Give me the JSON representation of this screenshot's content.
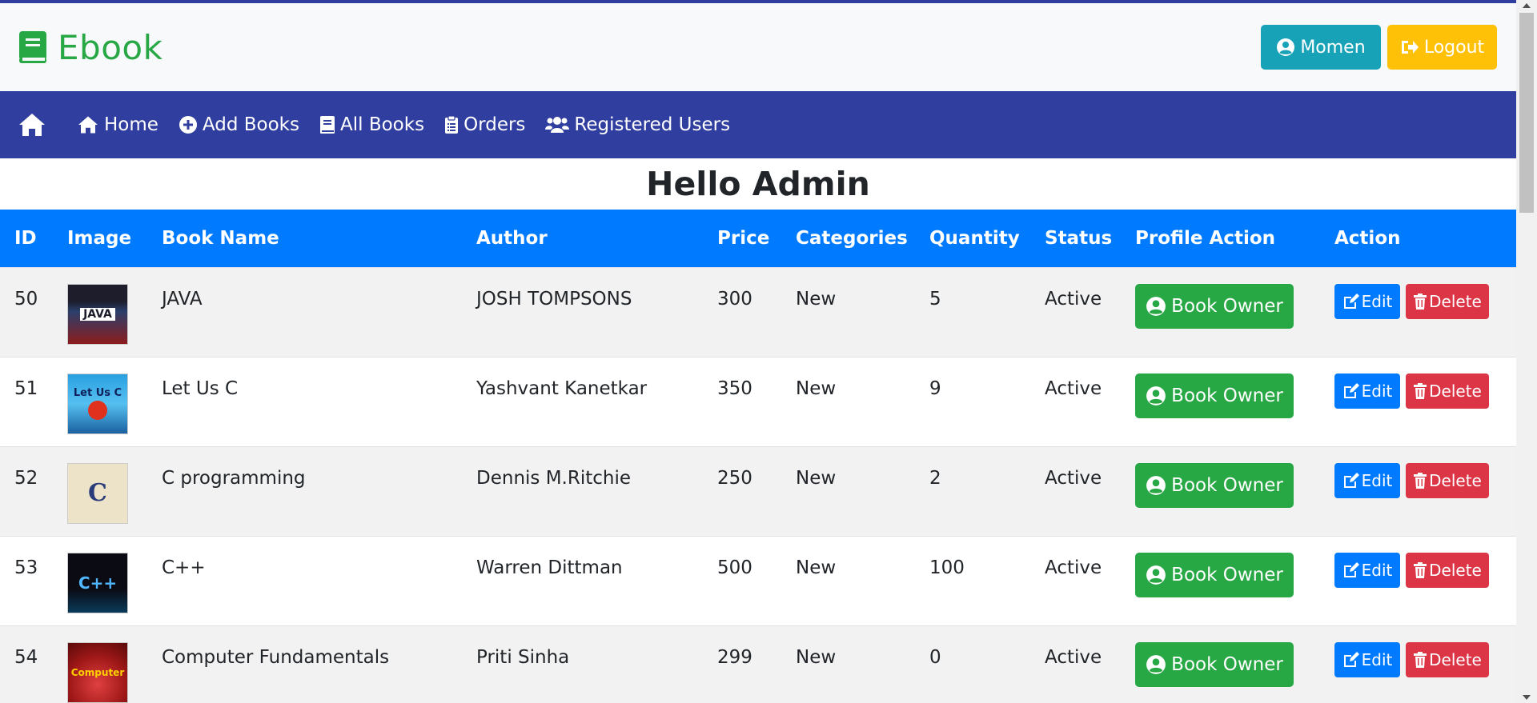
{
  "brand": {
    "name": "Ebook",
    "color": "#28a745",
    "icon": "book-icon"
  },
  "header": {
    "user_label": "Momen",
    "logout_label": "Logout"
  },
  "nav": {
    "home_icon": "home-icon",
    "items": [
      {
        "label": "Home",
        "icon": "home-icon"
      },
      {
        "label": "Add Books",
        "icon": "plus-circle-icon"
      },
      {
        "label": "All Books",
        "icon": "book-icon"
      },
      {
        "label": "Orders",
        "icon": "clipboard-icon"
      },
      {
        "label": "Registered Users",
        "icon": "users-icon"
      }
    ]
  },
  "page": {
    "title": "Hello Admin"
  },
  "table": {
    "columns": [
      "ID",
      "Image",
      "Book Name",
      "Author",
      "Price",
      "Categories",
      "Quantity",
      "Status",
      "Profile Action",
      "Action"
    ],
    "rows": [
      {
        "id": "50",
        "cover": "JAVA",
        "name": "JAVA",
        "author": "JOSH TOMPSONS",
        "price": "300",
        "category": "New",
        "quantity": "5",
        "status": "Active"
      },
      {
        "id": "51",
        "cover": "Let Us C",
        "name": "Let Us C",
        "author": "Yashvant Kanetkar",
        "price": "350",
        "category": "New",
        "quantity": "9",
        "status": "Active"
      },
      {
        "id": "52",
        "cover": "C",
        "name": "C programming",
        "author": "Dennis M.Ritchie",
        "price": "250",
        "category": "New",
        "quantity": "2",
        "status": "Active"
      },
      {
        "id": "53",
        "cover": "C++",
        "name": "C++",
        "author": "Warren Dittman",
        "price": "500",
        "category": "New",
        "quantity": "100",
        "status": "Active"
      },
      {
        "id": "54",
        "cover": "Computer",
        "name": "Computer Fundamentals",
        "author": "Priti Sinha",
        "price": "299",
        "category": "New",
        "quantity": "0",
        "status": "Active"
      }
    ],
    "owner_label": "Book Owner",
    "edit_label": "Edit",
    "delete_label": "Delete"
  },
  "colors": {
    "navbar": "#303f9f",
    "table_header": "#007bff",
    "user_button": "#17a2b8",
    "logout_button": "#ffc107",
    "owner_button": "#28a745",
    "edit_button": "#007bff",
    "delete_button": "#dc3545"
  }
}
